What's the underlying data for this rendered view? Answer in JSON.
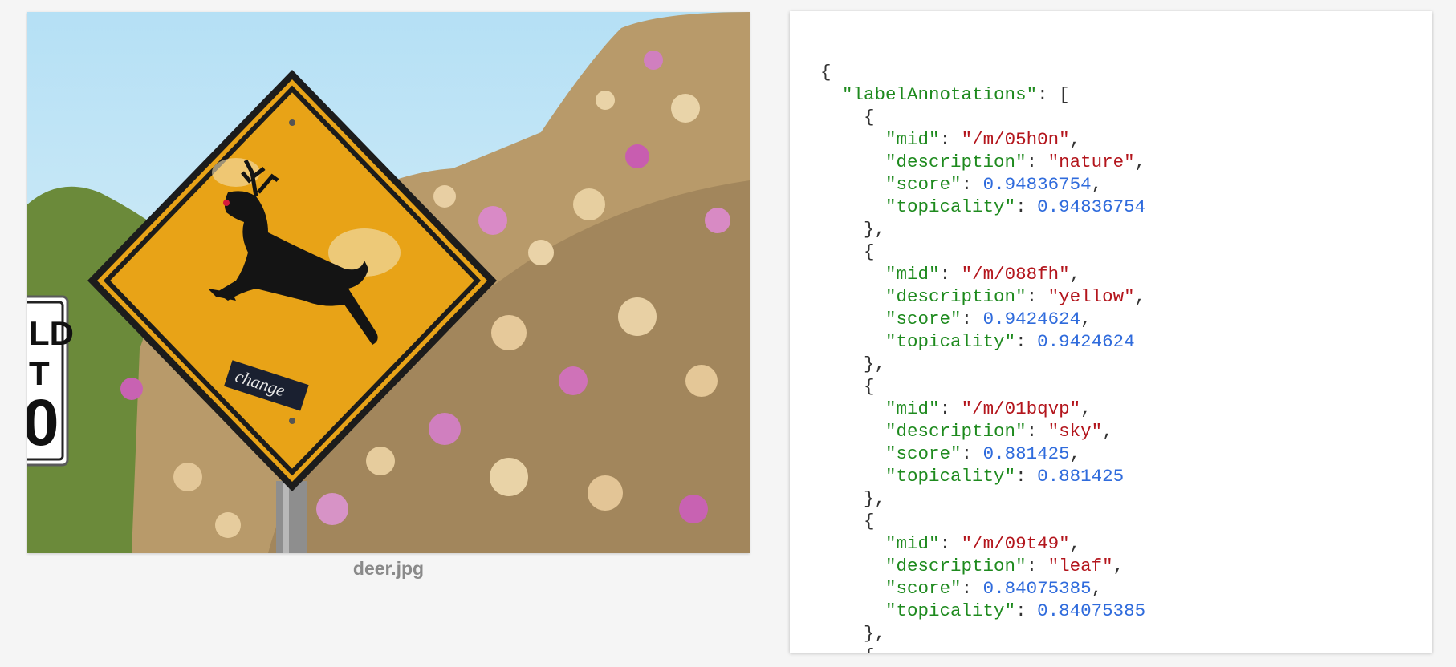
{
  "image": {
    "filename": "deer.jpg",
    "sign_sticker_text": "change"
  },
  "json_view": {
    "root_key": "labelAnnotations",
    "annotations": [
      {
        "mid": "/m/05h0n",
        "description": "nature",
        "score": "0.94836754",
        "topicality": "0.94836754"
      },
      {
        "mid": "/m/088fh",
        "description": "yellow",
        "score": "0.9424624",
        "topicality": "0.9424624"
      },
      {
        "mid": "/m/01bqvp",
        "description": "sky",
        "score": "0.881425",
        "topicality": "0.881425"
      },
      {
        "mid": "/m/09t49",
        "description": "leaf",
        "score": "0.84075385",
        "topicality": "0.84075385"
      }
    ],
    "field_names": {
      "mid": "mid",
      "description": "description",
      "score": "score",
      "topicality": "topicality"
    }
  },
  "colors": {
    "json_key": "#1e8a1e",
    "json_string": "#b3151c",
    "json_number": "#2f6bdc",
    "sign_yellow": "#e8a317",
    "sky": "#bfe3f2"
  }
}
